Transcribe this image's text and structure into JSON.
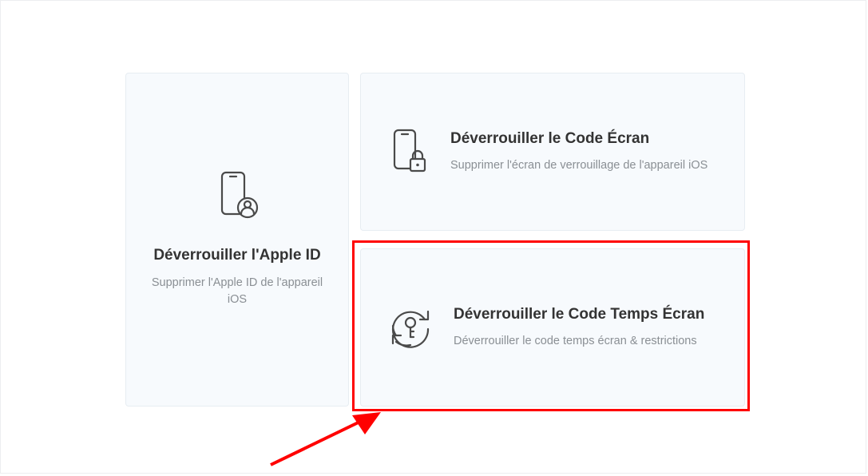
{
  "cards": {
    "apple_id": {
      "title": "Déverrouiller l'Apple ID",
      "subtitle": "Supprimer l'Apple ID de l'appareil iOS"
    },
    "screen_code": {
      "title": "Déverrouiller le Code Écran",
      "subtitle": "Supprimer l'écran de verrouillage de l'appareil iOS"
    },
    "screentime": {
      "title": "Déverrouiller le Code Temps Écran",
      "subtitle": "Déverrouiller le code temps écran & restrictions"
    }
  }
}
